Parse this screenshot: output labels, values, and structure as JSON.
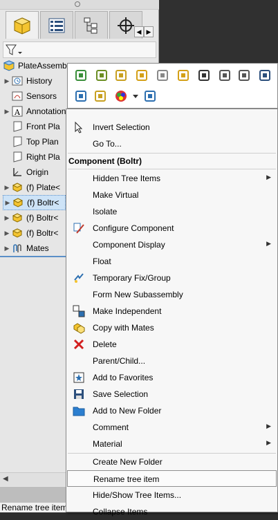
{
  "tree": {
    "root": "PlateAssemb",
    "items": [
      {
        "label": "History",
        "expand": true,
        "icon": "history-icon"
      },
      {
        "label": "Sensors",
        "expand": false,
        "icon": "sensors-icon"
      },
      {
        "label": "Annotations",
        "expand": true,
        "icon": "annotations-icon"
      },
      {
        "label": "Front Pla",
        "expand": false,
        "icon": "plane-icon"
      },
      {
        "label": "Top Plan",
        "expand": false,
        "icon": "plane-icon"
      },
      {
        "label": "Right Pla",
        "expand": false,
        "icon": "plane-icon"
      },
      {
        "label": "Origin",
        "expand": false,
        "icon": "origin-icon"
      },
      {
        "label": "(f) Plate<",
        "expand": true,
        "icon": "part-icon"
      },
      {
        "label": "(f) Boltr<",
        "expand": true,
        "icon": "part-icon"
      },
      {
        "label": "(f) Boltr<",
        "expand": true,
        "icon": "part-icon"
      },
      {
        "label": "(f) Boltr<",
        "expand": true,
        "icon": "part-icon"
      },
      {
        "label": "Mates",
        "expand": true,
        "icon": "mates-icon"
      }
    ]
  },
  "menu": {
    "header": "Component (Boltr)",
    "top_items": [
      {
        "label": "Invert Selection",
        "icon": "invert-selection-icon"
      },
      {
        "label": "Go To...",
        "icon": ""
      }
    ],
    "items": [
      {
        "label": "Hidden Tree Items",
        "icon": "",
        "submenu": true
      },
      {
        "label": "Make Virtual",
        "icon": ""
      },
      {
        "label": "Isolate",
        "icon": ""
      },
      {
        "label": "Configure Component",
        "icon": "configure-component-icon"
      },
      {
        "label": "Component Display",
        "icon": "",
        "submenu": true
      },
      {
        "label": "Float",
        "icon": ""
      },
      {
        "label": "Temporary Fix/Group",
        "icon": "temporary-fix-icon"
      },
      {
        "label": "Form New Subassembly",
        "icon": ""
      },
      {
        "label": "Make Independent",
        "icon": "make-independent-icon"
      },
      {
        "label": "Copy with Mates",
        "icon": "copy-with-mates-icon"
      },
      {
        "label": "Delete",
        "icon": "delete-icon"
      },
      {
        "label": "Parent/Child...",
        "icon": ""
      },
      {
        "label": "Add to Favorites",
        "icon": "favorites-icon"
      },
      {
        "label": "Save Selection",
        "icon": "save-selection-icon"
      },
      {
        "label": "Add to New Folder",
        "icon": "folder-icon"
      },
      {
        "label": "Comment",
        "icon": "",
        "submenu": true
      },
      {
        "label": "Material",
        "icon": "",
        "submenu": true
      }
    ],
    "bottom_items": [
      {
        "label": "Create New Folder"
      },
      {
        "label": "Rename tree item"
      },
      {
        "label": "Hide/Show Tree Items..."
      },
      {
        "label": "Collapse Items"
      }
    ]
  },
  "status": {
    "text": "Rename tree item"
  }
}
